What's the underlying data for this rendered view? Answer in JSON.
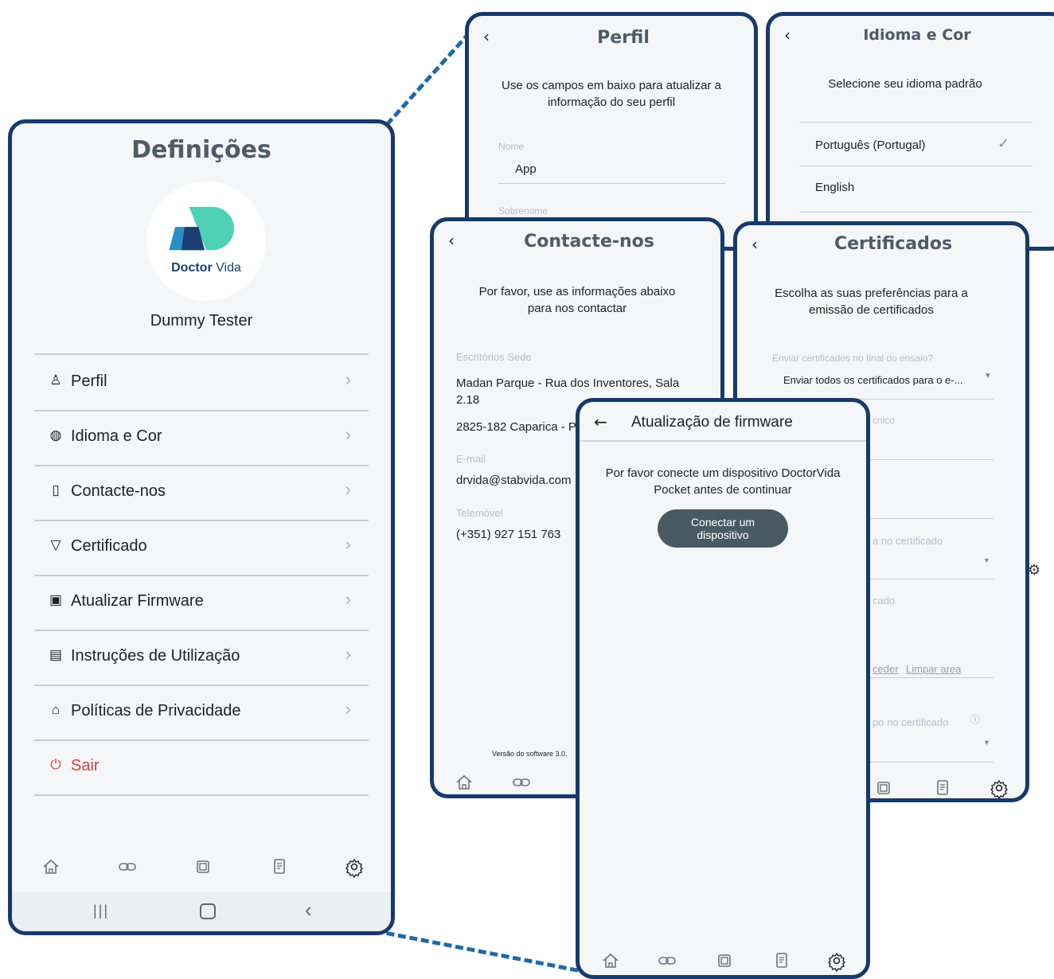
{
  "settings": {
    "title": "Definições",
    "logo_bold": "Doctor",
    "logo_light": "Vida",
    "user_name": "Dummy Tester",
    "menu": [
      {
        "label": "Perfil",
        "icon": "user-icon"
      },
      {
        "label": "Idioma e Cor",
        "icon": "globe-icon"
      },
      {
        "label": "Contacte-nos",
        "icon": "book-icon"
      },
      {
        "label": "Certificado",
        "icon": "certificate-icon"
      },
      {
        "label": "Atualizar Firmware",
        "icon": "chip-icon"
      },
      {
        "label": "Instruções de Utilização",
        "icon": "document-icon"
      },
      {
        "label": "Políticas de Privacidade",
        "icon": "lock-icon"
      },
      {
        "label": "Sair",
        "icon": "power-icon"
      }
    ],
    "android_nav": [
      "recents-icon",
      "home-icon",
      "back-icon"
    ]
  },
  "perfil": {
    "title": "Perfil",
    "back": "‹",
    "description": "Use os campos em baixo para atualizar a informação do seu perfil",
    "fields": [
      {
        "label": "Nome",
        "value": "App"
      },
      {
        "label": "Sobrenome",
        "value": ""
      }
    ]
  },
  "idioma": {
    "title": "Idioma e Cor",
    "back": "‹",
    "description": "Selecione seu idioma padrão",
    "options": [
      {
        "label": "Português (Portugal)",
        "selected": true,
        "check": "✓"
      },
      {
        "label": "English",
        "selected": false
      }
    ]
  },
  "contacte": {
    "title": "Contacte-nos",
    "back": "‹",
    "description": "Por favor, use as informações abaixo para nos contactar",
    "office_label": "Escritórios Sede",
    "address_line1": "Madan Parque - Rua dos Inventores, Sala 2.18",
    "address_line2": "2825-182 Caparica - P",
    "email_label": "E-mail",
    "email": "drvida@stabvida.com",
    "phone_label": "Telemóvel",
    "phone": "(+351) 927 151 763",
    "version": "Versão do software 3.0."
  },
  "certificados": {
    "title": "Certificados",
    "back": "‹",
    "description": "Escolha as suas preferências para a emissão de certificados",
    "select_label": "Enviar certificados no final do ensaio?",
    "select_value": "Enviar todos os certificados para o e-...",
    "partial_labels": [
      "cnico",
      "a no certificado",
      "cado",
      "po no certificado"
    ],
    "link_proceed": "ceder",
    "link_clear": "Limpar area"
  },
  "firmware": {
    "title": "Atualização de firmware",
    "back": "←",
    "description": "Por favor conecte um dispositivo DoctorVida Pocket antes de continuar",
    "button_label": "Conectar um dispositivo"
  },
  "colors": {
    "frame": "#173a6b",
    "accent_teal": "#4fd1b5",
    "button_bg": "#4a5a62",
    "danger": "#d94040",
    "dash": "#1f6aa6"
  }
}
